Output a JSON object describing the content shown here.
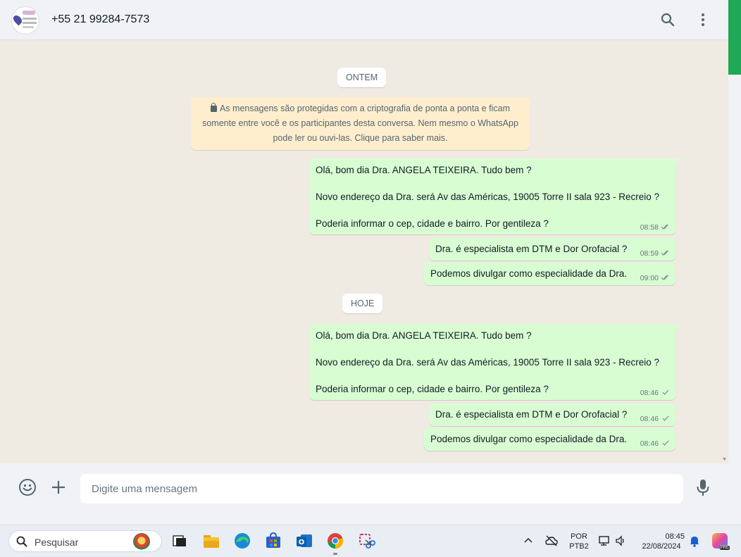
{
  "header": {
    "contact_name": "+55 21 99284-7573",
    "search_icon": "search-icon",
    "menu_icon": "kebab-menu-icon"
  },
  "chat": {
    "date_yesterday": "ONTEM",
    "date_today": "HOJE",
    "encryption_notice": {
      "line1": "As mensagens são protegidas com a criptografia de ponta a ponta e ficam",
      "line2": "somente entre você e os participantes desta conversa. Nem mesmo o WhatsApp",
      "line3": "pode ler ou ouvi-las. Clique para saber mais."
    },
    "yesterday_messages": [
      {
        "lines": [
          "Olá, bom dia Dra. ANGELA TEIXEIRA. Tudo bem ?",
          "Novo endereço da Dra. será Av das Américas,  19005 Torre II sala 923 - Recreio ?",
          "Poderia informar o cep, cidade e bairro. Por gentileza ?"
        ],
        "time": "08:58",
        "status": "read"
      },
      {
        "lines": [
          "Dra. é especialista em  DTM e Dor Orofacial ?"
        ],
        "time": "08:59",
        "status": "read"
      },
      {
        "lines": [
          "Podemos divulgar como especialidade da Dra."
        ],
        "time": "09:00",
        "status": "read"
      }
    ],
    "today_messages": [
      {
        "lines": [
          "Olá, bom dia Dra. ANGELA TEIXEIRA. Tudo bem ?",
          "Novo endereço da Dra. será Av das Américas,  19005 Torre II sala 923 - Recreio ?",
          "Poderia informar o cep, cidade e bairro. Por gentileza ?"
        ],
        "time": "08:46",
        "status": "sent"
      },
      {
        "lines": [
          "Dra. é especialista em  DTM e Dor Orofacial ?"
        ],
        "time": "08:46",
        "status": "sent"
      },
      {
        "lines": [
          "Podemos divulgar como especialidade da Dra."
        ],
        "time": "08:46",
        "status": "sent"
      }
    ]
  },
  "composer": {
    "placeholder": "Digite uma mensagem"
  },
  "taskbar": {
    "search_label": "Pesquisar",
    "lang_line1": "POR",
    "lang_line2": "PTB2",
    "time": "08:45",
    "date": "22/08/2024",
    "copilot_badge": "PRE"
  },
  "colors": {
    "outgoing_bubble": "#d9fdd3",
    "read_tick": "#53bdeb",
    "accent": "#1fa855"
  }
}
